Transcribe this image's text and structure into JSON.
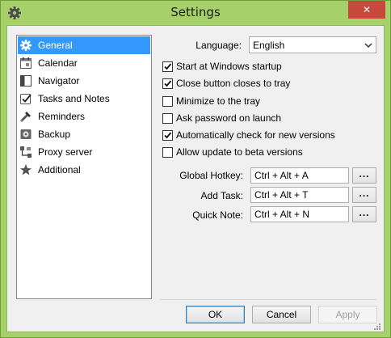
{
  "window": {
    "title": "Settings",
    "close_glyph": "✕"
  },
  "sidebar": {
    "items": [
      {
        "label": "General",
        "icon": "gear-icon",
        "selected": true
      },
      {
        "label": "Calendar",
        "icon": "calendar-icon",
        "selected": false
      },
      {
        "label": "Navigator",
        "icon": "navigator-icon",
        "selected": false
      },
      {
        "label": "Tasks and Notes",
        "icon": "checkbox-icon",
        "selected": false
      },
      {
        "label": "Reminders",
        "icon": "reminder-icon",
        "selected": false
      },
      {
        "label": "Backup",
        "icon": "backup-icon",
        "selected": false
      },
      {
        "label": "Proxy server",
        "icon": "proxy-icon",
        "selected": false
      },
      {
        "label": "Additional",
        "icon": "star-icon",
        "selected": false
      }
    ]
  },
  "language": {
    "label": "Language:",
    "value": "English"
  },
  "options": [
    {
      "label": "Start at Windows startup",
      "checked": true
    },
    {
      "label": "Close button closes to tray",
      "checked": true
    },
    {
      "label": "Minimize to the tray",
      "checked": false
    },
    {
      "label": "Ask password on launch",
      "checked": false
    },
    {
      "label": "Automatically check for new versions",
      "checked": true
    },
    {
      "label": "Allow update to beta versions",
      "checked": false
    }
  ],
  "hotkeys": [
    {
      "label": "Global Hotkey:",
      "value": "Ctrl + Alt + A",
      "button": "..."
    },
    {
      "label": "Add Task:",
      "value": "Ctrl + Alt + T",
      "button": "..."
    },
    {
      "label": "Quick Note:",
      "value": "Ctrl + Alt + N",
      "button": "..."
    }
  ],
  "buttons": {
    "ok": "OK",
    "cancel": "Cancel",
    "apply": "Apply"
  },
  "colors": {
    "frame": "#a6d16a",
    "selection": "#3399ff",
    "close": "#c9483d"
  }
}
